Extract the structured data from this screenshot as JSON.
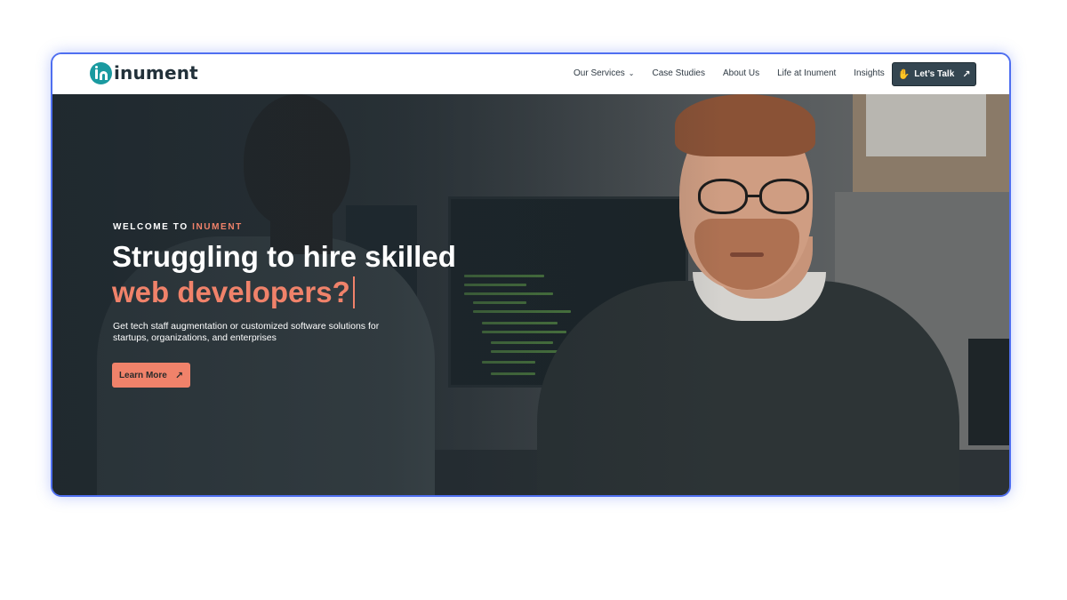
{
  "header": {
    "logo_text": "inument",
    "nav": [
      {
        "label": "Our Services",
        "has_dropdown": true
      },
      {
        "label": "Case Studies"
      },
      {
        "label": "About Us"
      },
      {
        "label": "Life at Inument"
      },
      {
        "label": "Insights"
      }
    ],
    "cta": {
      "label": "Let’s Talk",
      "icon": "waving-hand-icon",
      "arrow": "↗"
    }
  },
  "hero": {
    "eyebrow_prefix": "WELCOME TO ",
    "eyebrow_brand": "INUMENT",
    "headline_line1": "Struggling to hire skilled",
    "headline_line2": "web developers?",
    "subtitle": "Get tech staff augmentation or customized software solutions for startups, organizations, and enterprises",
    "button": {
      "label": "Learn More",
      "arrow": "↗"
    }
  },
  "colors": {
    "accent": "#f0826a",
    "brand_teal": "#1a9aa0",
    "cta_bg": "#344651",
    "frame_border": "#4f6ff0"
  }
}
